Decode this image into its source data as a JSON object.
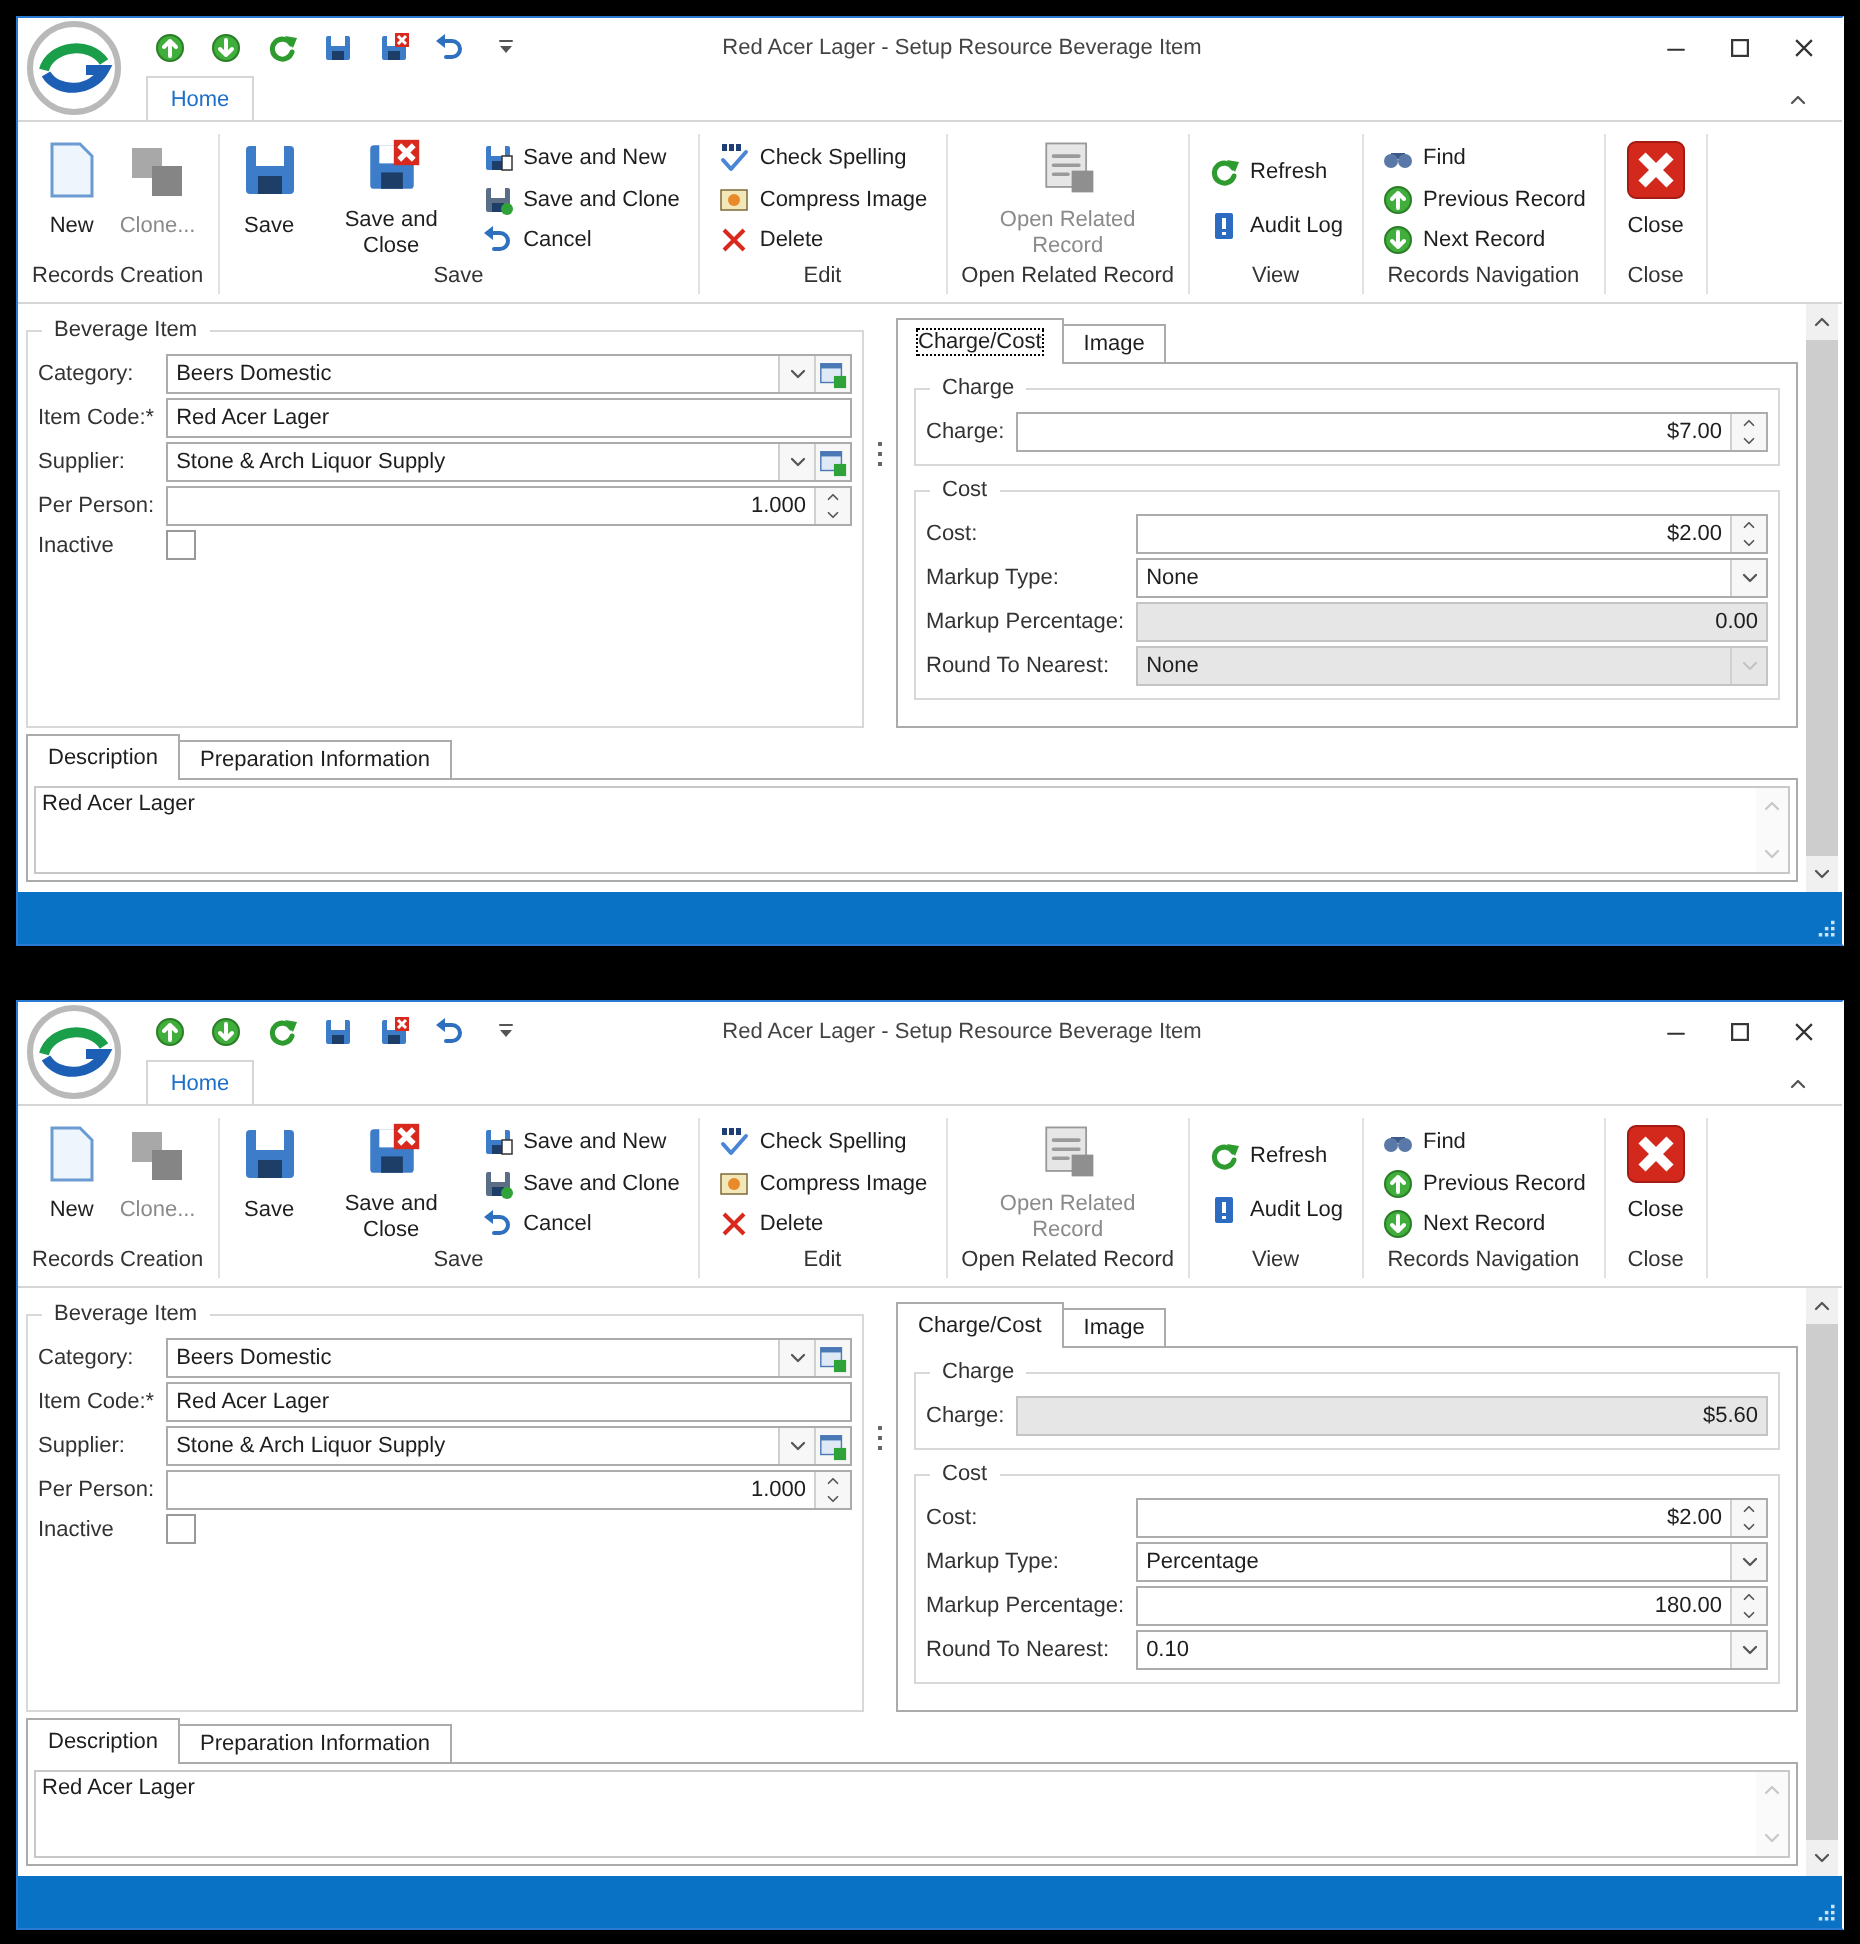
{
  "windows": [
    {
      "title": "Red Acer Lager - Setup Resource Beverage Item",
      "ribbon_tabs": [
        {
          "label": "Home",
          "selected": true
        }
      ],
      "ribbon_groups": [
        {
          "label": "Records Creation",
          "items": [
            {
              "label": "New",
              "kind": "large",
              "disabled": false
            },
            {
              "label": "Clone...",
              "kind": "large",
              "disabled": true
            }
          ]
        },
        {
          "label": "Save",
          "items": [
            {
              "label": "Save",
              "kind": "large",
              "disabled": false
            },
            {
              "label": "Save and Close",
              "kind": "large",
              "disabled": false
            },
            {
              "label": "Save and New",
              "kind": "small",
              "disabled": false
            },
            {
              "label": "Save and Clone",
              "kind": "small",
              "disabled": false
            },
            {
              "label": "Cancel",
              "kind": "small",
              "disabled": false
            }
          ]
        },
        {
          "label": "Edit",
          "items": [
            {
              "label": "Check Spelling",
              "kind": "small",
              "disabled": false
            },
            {
              "label": "Compress Image",
              "kind": "small",
              "disabled": false
            },
            {
              "label": "Delete",
              "kind": "small",
              "disabled": false
            }
          ]
        },
        {
          "label": "Open Related Record",
          "items": [
            {
              "label": "Open Related Record",
              "kind": "large",
              "disabled": true
            }
          ]
        },
        {
          "label": "View",
          "items": [
            {
              "label": "Refresh",
              "kind": "small",
              "disabled": false
            },
            {
              "label": "Audit Log",
              "kind": "small",
              "disabled": false
            }
          ]
        },
        {
          "label": "Records Navigation",
          "items": [
            {
              "label": "Find",
              "kind": "small",
              "disabled": false
            },
            {
              "label": "Previous Record",
              "kind": "small",
              "disabled": false
            },
            {
              "label": "Next Record",
              "kind": "small",
              "disabled": false
            }
          ]
        },
        {
          "label": "Close",
          "items": [
            {
              "label": "Close",
              "kind": "large",
              "disabled": false
            }
          ]
        }
      ],
      "beverage_item": {
        "title": "Beverage Item",
        "fields": [
          {
            "label": "Category:",
            "value": "Beers Domestic",
            "kind": "lookup_combo"
          },
          {
            "label": "Item Code:*",
            "value": "Red Acer Lager",
            "kind": "text"
          },
          {
            "label": "Supplier:",
            "value": "Stone & Arch Liquor Supply",
            "kind": "lookup_combo"
          },
          {
            "label": "Per Person:",
            "value": "1.000",
            "kind": "spin"
          },
          {
            "label": "Inactive",
            "kind": "checkbox",
            "checked": false
          }
        ]
      },
      "pricing": {
        "tabs": [
          {
            "label": "Charge/Cost",
            "selected": true,
            "focused": true
          },
          {
            "label": "Image",
            "selected": false,
            "focused": false
          }
        ],
        "groups": [
          {
            "title": "Charge",
            "fields": [
              {
                "label": "Charge:",
                "value": "$7.00",
                "kind": "spin",
                "disabled": false
              }
            ]
          },
          {
            "title": "Cost",
            "fields": [
              {
                "label": "Cost:",
                "value": "$2.00",
                "kind": "spin",
                "disabled": false
              },
              {
                "label": "Markup Type:",
                "value": "None",
                "kind": "combo",
                "disabled": false
              },
              {
                "label": "Markup Percentage:",
                "value": "0.00",
                "kind": "spin",
                "disabled": true
              },
              {
                "label": "Round To Nearest:",
                "value": "None",
                "kind": "combo",
                "disabled": true
              }
            ]
          }
        ]
      },
      "description": {
        "tabs": [
          {
            "label": "Description",
            "selected": true
          },
          {
            "label": "Preparation Information",
            "selected": false
          }
        ],
        "value": "Red Acer Lager"
      }
    },
    {
      "title": "Red Acer Lager - Setup Resource Beverage Item",
      "ribbon_tabs": [
        {
          "label": "Home",
          "selected": true
        }
      ],
      "ribbon_groups": [
        {
          "label": "Records Creation",
          "items": [
            {
              "label": "New",
              "kind": "large",
              "disabled": false
            },
            {
              "label": "Clone...",
              "kind": "large",
              "disabled": true
            }
          ]
        },
        {
          "label": "Save",
          "items": [
            {
              "label": "Save",
              "kind": "large",
              "disabled": false
            },
            {
              "label": "Save and Close",
              "kind": "large",
              "disabled": false
            },
            {
              "label": "Save and New",
              "kind": "small",
              "disabled": false
            },
            {
              "label": "Save and Clone",
              "kind": "small",
              "disabled": false
            },
            {
              "label": "Cancel",
              "kind": "small",
              "disabled": false
            }
          ]
        },
        {
          "label": "Edit",
          "items": [
            {
              "label": "Check Spelling",
              "kind": "small",
              "disabled": false
            },
            {
              "label": "Compress Image",
              "kind": "small",
              "disabled": false
            },
            {
              "label": "Delete",
              "kind": "small",
              "disabled": false
            }
          ]
        },
        {
          "label": "Open Related Record",
          "items": [
            {
              "label": "Open Related Record",
              "kind": "large",
              "disabled": true
            }
          ]
        },
        {
          "label": "View",
          "items": [
            {
              "label": "Refresh",
              "kind": "small",
              "disabled": false
            },
            {
              "label": "Audit Log",
              "kind": "small",
              "disabled": false
            }
          ]
        },
        {
          "label": "Records Navigation",
          "items": [
            {
              "label": "Find",
              "kind": "small",
              "disabled": false
            },
            {
              "label": "Previous Record",
              "kind": "small",
              "disabled": false
            },
            {
              "label": "Next Record",
              "kind": "small",
              "disabled": false
            }
          ]
        },
        {
          "label": "Close",
          "items": [
            {
              "label": "Close",
              "kind": "large",
              "disabled": false
            }
          ]
        }
      ],
      "beverage_item": {
        "title": "Beverage Item",
        "fields": [
          {
            "label": "Category:",
            "value": "Beers Domestic",
            "kind": "lookup_combo"
          },
          {
            "label": "Item Code:*",
            "value": "Red Acer Lager",
            "kind": "text"
          },
          {
            "label": "Supplier:",
            "value": "Stone & Arch Liquor Supply",
            "kind": "lookup_combo"
          },
          {
            "label": "Per Person:",
            "value": "1.000",
            "kind": "spin"
          },
          {
            "label": "Inactive",
            "kind": "checkbox",
            "checked": false
          }
        ]
      },
      "pricing": {
        "tabs": [
          {
            "label": "Charge/Cost",
            "selected": true,
            "focused": false
          },
          {
            "label": "Image",
            "selected": false,
            "focused": false
          }
        ],
        "groups": [
          {
            "title": "Charge",
            "fields": [
              {
                "label": "Charge:",
                "value": "$5.60",
                "kind": "spin",
                "disabled": true
              }
            ]
          },
          {
            "title": "Cost",
            "fields": [
              {
                "label": "Cost:",
                "value": "$2.00",
                "kind": "spin",
                "disabled": false
              },
              {
                "label": "Markup Type:",
                "value": "Percentage",
                "kind": "combo",
                "disabled": false
              },
              {
                "label": "Markup Percentage:",
                "value": "180.00",
                "kind": "spin",
                "disabled": false
              },
              {
                "label": "Round To Nearest:",
                "value": "0.10",
                "kind": "combo",
                "disabled": false
              }
            ]
          }
        ]
      },
      "description": {
        "tabs": [
          {
            "label": "Description",
            "selected": true
          },
          {
            "label": "Preparation Information",
            "selected": false
          }
        ],
        "value": "Red Acer Lager"
      }
    }
  ]
}
